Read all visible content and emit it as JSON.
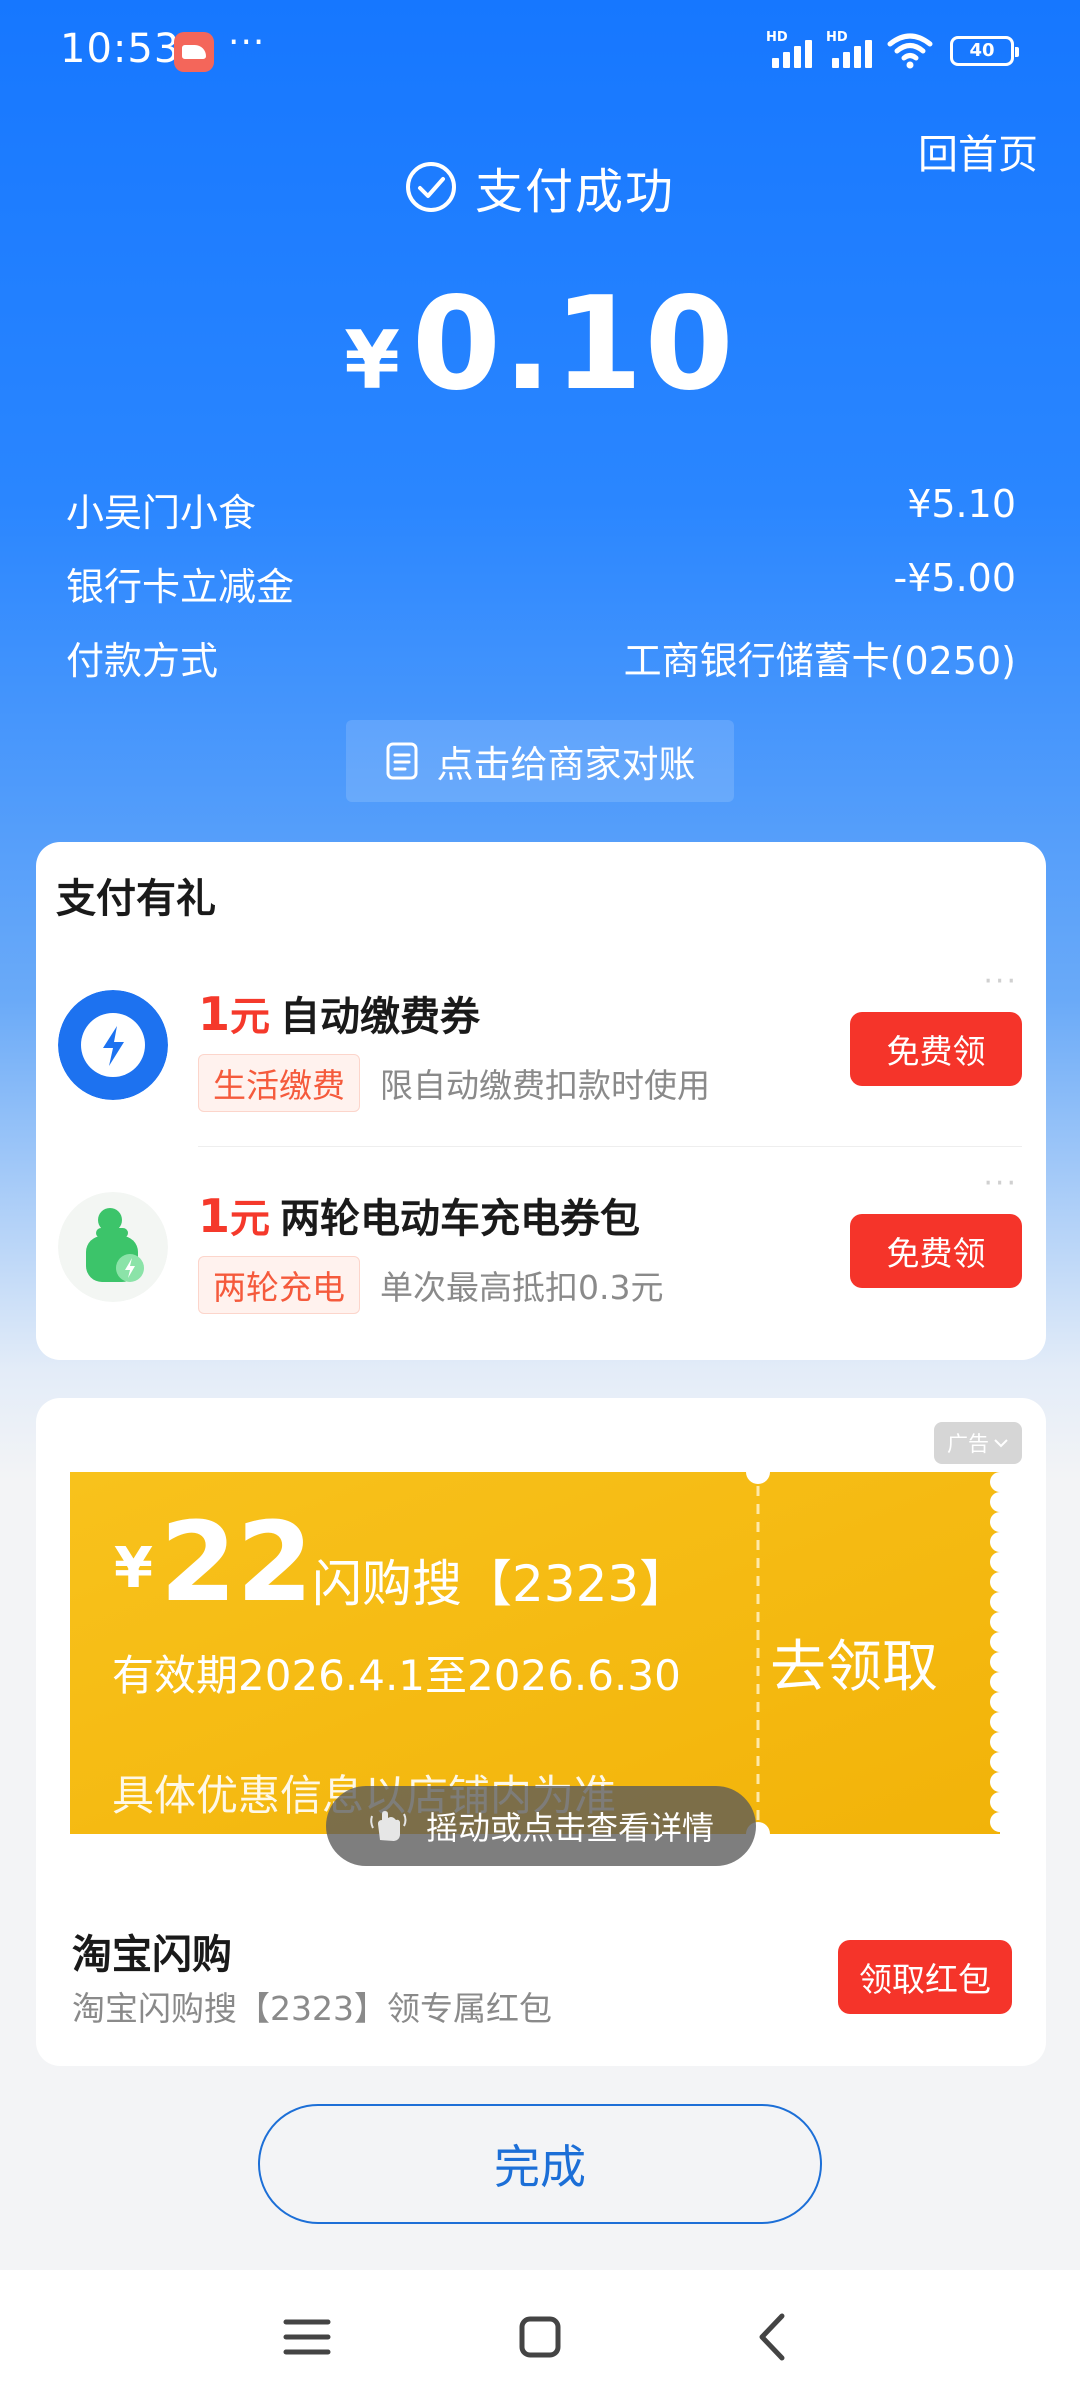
{
  "status_bar": {
    "time": "10:53",
    "dots": "···",
    "signal_label_1": "HD",
    "signal_label_2": "HD",
    "battery": "40"
  },
  "header": {
    "home_link": "回首页",
    "status_text": "支付成功",
    "currency": "¥",
    "amount": "0.10"
  },
  "details": [
    {
      "label": "小吴门小食",
      "value": "¥5.10"
    },
    {
      "label": "银行卡立减金",
      "value": "-¥5.00"
    },
    {
      "label": "付款方式",
      "value": "工商银行储蓄卡(0250)"
    }
  ],
  "reconcile_button": "点击给商家对账",
  "gift_section": {
    "title": "支付有礼",
    "offers": [
      {
        "num": "1",
        "unit": "元",
        "title": "自动缴费券",
        "tag": "生活缴费",
        "desc": "限自动缴费扣款时使用",
        "button": "免费领",
        "dots": "···"
      },
      {
        "num": "1",
        "unit": "元",
        "title": "两轮电动车充电券包",
        "tag": "两轮充电",
        "desc": "单次最高抵扣0.3元",
        "button": "免费领",
        "dots": "···"
      }
    ]
  },
  "ad": {
    "tag": "广告",
    "coupon": {
      "currency": "¥",
      "value": "22",
      "name": "闪购搜【2323】",
      "validity": "有效期2026.4.1至2026.6.30",
      "note": "具体优惠信息以店铺内为准",
      "cta": "去领取"
    },
    "shake_hint": "摇动或点击查看详情",
    "brand": "淘宝闪购",
    "description": "淘宝闪购搜【2323】领专属红包",
    "button": "领取红包"
  },
  "done_button": "完成",
  "colors": {
    "brand_blue": "#1677ff",
    "red_button": "#f5342a",
    "coupon_yellow": "#f7bd0f",
    "done_blue": "#1c6fd7"
  }
}
